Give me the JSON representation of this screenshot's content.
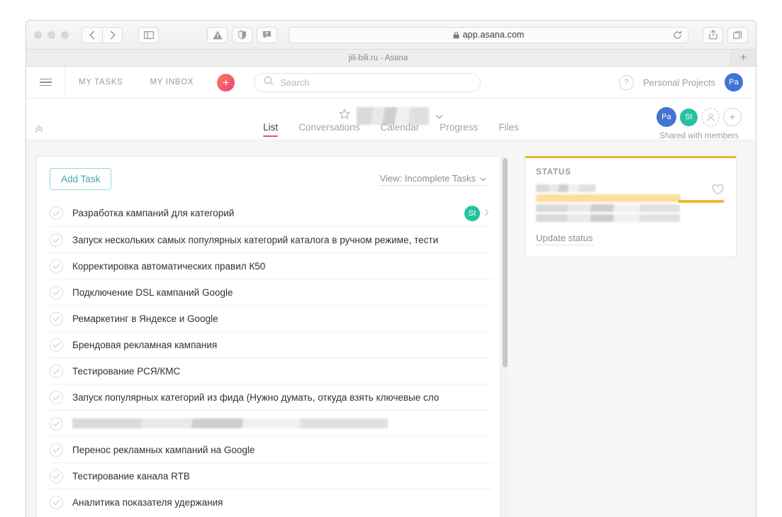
{
  "browser": {
    "url": "app.asana.com",
    "tab_title": "jili-bili.ru - Asana",
    "icons": {
      "back": "back-chevron-icon",
      "forward": "forward-chevron-icon",
      "sidebar": "sidebar-toggle-icon",
      "warning": "warning-triangle-icon",
      "shield": "shield-icon",
      "flag": "flag-icon",
      "lock": "lock-icon",
      "reload": "reload-icon",
      "share": "share-icon",
      "tabs": "tabs-overview-icon",
      "new_tab": "+"
    }
  },
  "topbar": {
    "menu_icon": "hamburger-menu-icon",
    "my_tasks": "MY TASKS",
    "my_inbox": "MY INBOX",
    "quick_add": "+",
    "search_placeholder": "Search",
    "search_value": "",
    "help": "?",
    "workspace": "Personal Projects",
    "user_initials": "Pa"
  },
  "project": {
    "name": "",
    "name_redacted": true,
    "star_icon": "star-icon",
    "chevron_icon": "chevron-down-icon",
    "collapse_icon": "collapse-up-icon",
    "tabs": [
      {
        "label": "List",
        "active": true
      },
      {
        "label": "Conversations",
        "active": false
      },
      {
        "label": "Calendar",
        "active": false
      },
      {
        "label": "Progress",
        "active": false
      },
      {
        "label": "Files",
        "active": false
      }
    ],
    "members": [
      {
        "initials": "Pa",
        "color": "#4573d2"
      },
      {
        "initials": "St",
        "color": "#25c2a0"
      }
    ],
    "invite_icon": "person-dashed-icon",
    "add_member": "+",
    "shared_label": "Shared with members"
  },
  "list": {
    "add_task_label": "Add Task",
    "view_label": "View: Incomplete Tasks",
    "view_chevron": "chevron-down-icon",
    "tasks": [
      {
        "name": "Разработка кампаний для категорий",
        "redacted": false,
        "assignee": "St",
        "assignee_color": "#25c2a0",
        "has_chevron": true
      },
      {
        "name": "Запуск нескольких самых популярных категорий каталога в ручном режиме, тести",
        "redacted": false,
        "assignee": null,
        "has_chevron": false
      },
      {
        "name": "Корректировка автоматических правил К50",
        "redacted": false,
        "assignee": null,
        "has_chevron": false
      },
      {
        "name": "Подключение DSL кампаний Google",
        "redacted": false,
        "assignee": null,
        "has_chevron": false
      },
      {
        "name": "Ремаркетинг в Яндексе и Google",
        "redacted": false,
        "assignee": null,
        "has_chevron": false
      },
      {
        "name": "Брендовая рекламная кампания",
        "redacted": false,
        "assignee": null,
        "has_chevron": false
      },
      {
        "name": "Тестирование РСЯ/КМС",
        "redacted": false,
        "assignee": null,
        "has_chevron": false
      },
      {
        "name": "Запуск популярных категорий из фида (Нужно думать, откуда взять ключевые сло",
        "redacted": false,
        "assignee": null,
        "has_chevron": false
      },
      {
        "name": "",
        "redacted": true,
        "assignee": null,
        "has_chevron": false
      },
      {
        "name": "Перенос рекламных кампаний на Google",
        "redacted": false,
        "assignee": null,
        "has_chevron": false
      },
      {
        "name": "Тестирование канала RTB",
        "redacted": false,
        "assignee": null,
        "has_chevron": false
      },
      {
        "name": "Аналитика показателя удержания",
        "redacted": false,
        "assignee": null,
        "has_chevron": false
      }
    ]
  },
  "status": {
    "title": "STATUS",
    "accent_color": "#f1b530",
    "body_redacted": true,
    "heart_icon": "heart-icon",
    "update_link": "Update status"
  }
}
